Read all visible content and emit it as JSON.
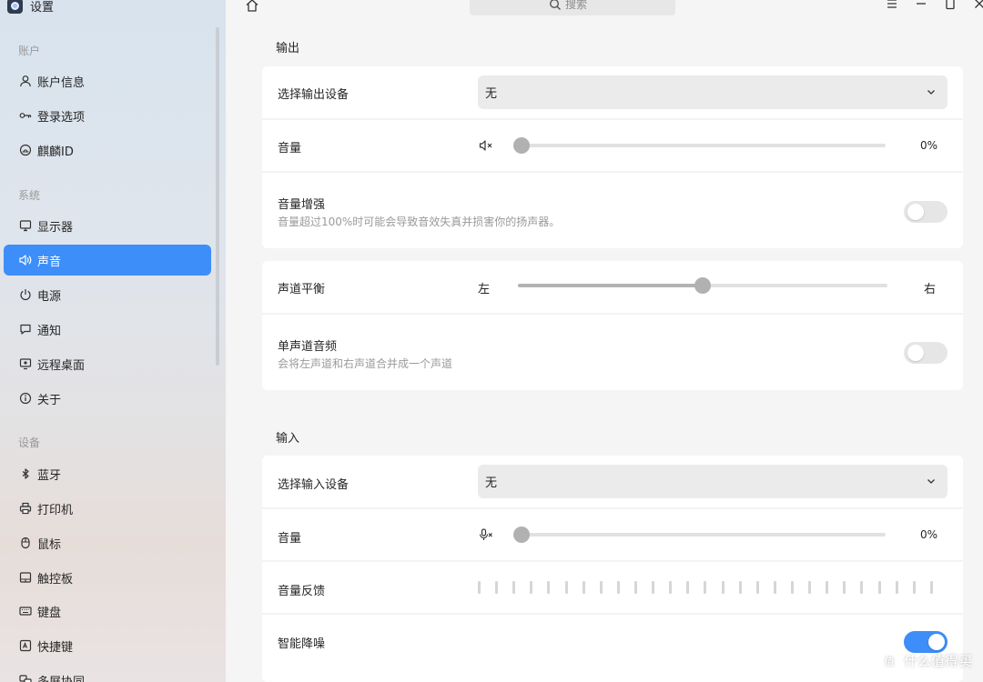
{
  "app": {
    "title": "设置"
  },
  "search": {
    "placeholder": "搜索"
  },
  "sidebar": {
    "groups": [
      {
        "title": "账户",
        "items": [
          {
            "label": "账户信息",
            "icon": "user-icon"
          },
          {
            "label": "登录选项",
            "icon": "key-icon"
          },
          {
            "label": "麒麟ID",
            "icon": "cloud-icon"
          }
        ]
      },
      {
        "title": "系统",
        "items": [
          {
            "label": "显示器",
            "icon": "monitor-icon"
          },
          {
            "label": "声音",
            "icon": "speaker-icon",
            "active": true
          },
          {
            "label": "电源",
            "icon": "power-icon"
          },
          {
            "label": "通知",
            "icon": "notification-icon"
          },
          {
            "label": "远程桌面",
            "icon": "remote-desktop-icon"
          },
          {
            "label": "关于",
            "icon": "info-icon"
          }
        ]
      },
      {
        "title": "设备",
        "items": [
          {
            "label": "蓝牙",
            "icon": "bluetooth-icon"
          },
          {
            "label": "打印机",
            "icon": "printer-icon"
          },
          {
            "label": "鼠标",
            "icon": "mouse-icon"
          },
          {
            "label": "触控板",
            "icon": "touchpad-icon"
          },
          {
            "label": "键盘",
            "icon": "keyboard-icon"
          },
          {
            "label": "快捷键",
            "icon": "shortcut-icon"
          },
          {
            "label": "多屏协同",
            "icon": "multiscreen-icon"
          }
        ]
      }
    ]
  },
  "output": {
    "section_title": "输出",
    "device": {
      "label": "选择输出设备",
      "value": "无"
    },
    "volume": {
      "label": "音量",
      "value_text": "0%",
      "level": 0
    },
    "boost": {
      "label": "音量增强",
      "description": "音量超过100%时可能会导致音效失真并损害你的扬声器。",
      "enabled": false
    },
    "balance": {
      "label": "声道平衡",
      "left_label": "左",
      "right_label": "右",
      "position": 0.5
    },
    "mono": {
      "label": "单声道音频",
      "description": "会将左声道和右声道合并成一个声道",
      "enabled": false
    }
  },
  "input": {
    "section_title": "输入",
    "device": {
      "label": "选择输入设备",
      "value": "无"
    },
    "volume": {
      "label": "音量",
      "value_text": "0%",
      "level": 0
    },
    "feedback": {
      "label": "音量反馈",
      "level": 0
    },
    "noise_reduction": {
      "label": "智能降噪",
      "enabled": true
    }
  },
  "watermark": {
    "text": "什么值得买",
    "logo": "值"
  },
  "colors": {
    "accent": "#3d8ef8",
    "card": "#ffffff",
    "background": "#f5f5f5"
  }
}
